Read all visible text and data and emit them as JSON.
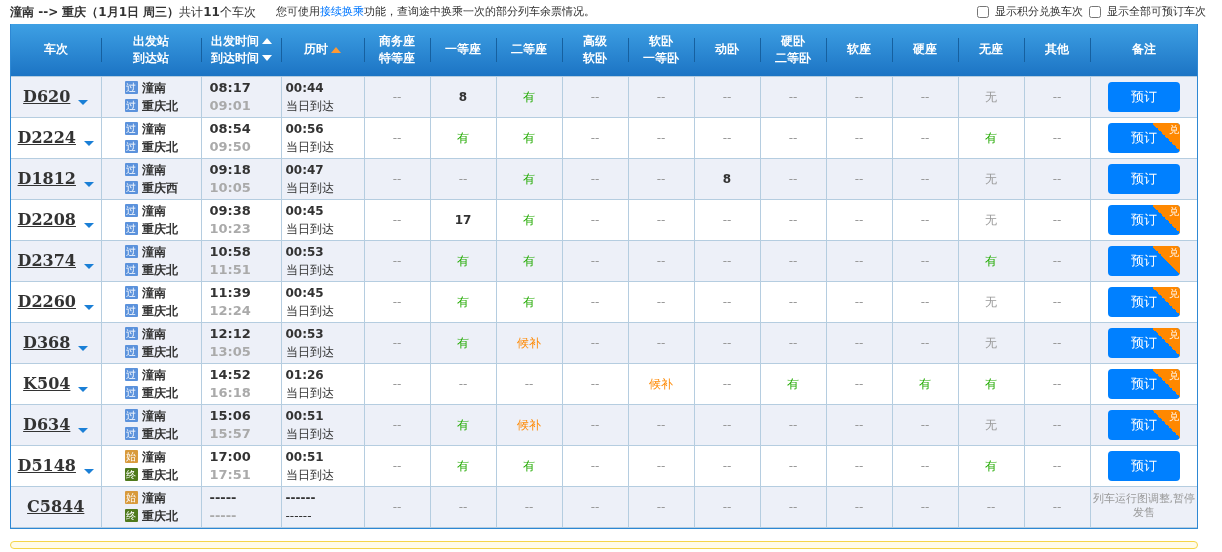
{
  "summary": "**潼南 --> 重庆（1月1日  周三）**共计**11**个车次",
  "notice": {
    "before": "您可使用",
    "link": "接续换乘",
    "after": "功能，查询途中换乘一次的部分列车余票情况。"
  },
  "filters": [
    {
      "label": "显示积分兑换车次",
      "checked": false
    },
    {
      "label": "显示全部可预订车次",
      "checked": false
    }
  ],
  "columns": [
    {
      "lines": [
        "车次"
      ]
    },
    {
      "lines": [
        "出发站",
        "到达站"
      ]
    },
    {
      "lines": [
        "出发时间",
        "到达时间"
      ],
      "sortable": true,
      "sort_active": false
    },
    {
      "lines": [
        "历时"
      ],
      "sortable": true,
      "sort_active": true
    },
    {
      "lines": [
        "商务座",
        "特等座"
      ]
    },
    {
      "lines": [
        "一等座"
      ]
    },
    {
      "lines": [
        "二等座"
      ]
    },
    {
      "lines": [
        "高级",
        "软卧"
      ]
    },
    {
      "lines": [
        "软卧",
        "一等卧"
      ]
    },
    {
      "lines": [
        "动卧"
      ]
    },
    {
      "lines": [
        "硬卧",
        "二等卧"
      ]
    },
    {
      "lines": [
        "软座"
      ]
    },
    {
      "lines": [
        "硬座"
      ]
    },
    {
      "lines": [
        "无座"
      ]
    },
    {
      "lines": [
        "其他"
      ]
    },
    {
      "lines": [
        "备注"
      ]
    }
  ],
  "rows": [
    {
      "train": "D620",
      "from": {
        "tag": "过",
        "kind": "pass",
        "name": "潼南"
      },
      "to": {
        "tag": "过",
        "kind": "pass",
        "name": "重庆北"
      },
      "depart": "08:17",
      "arrive": "09:01",
      "duration": "00:44",
      "arrival_day": "当日到达",
      "seats": [
        {
          "text": "--",
          "kind": "na"
        },
        {
          "text": "8",
          "kind": "count"
        },
        {
          "text": "有",
          "kind": "yes"
        },
        {
          "text": "--",
          "kind": "na"
        },
        {
          "text": "--",
          "kind": "na"
        },
        {
          "text": "--",
          "kind": "na"
        },
        {
          "text": "--",
          "kind": "na"
        },
        {
          "text": "--",
          "kind": "na"
        },
        {
          "text": "--",
          "kind": "na"
        },
        {
          "text": "无",
          "kind": "none"
        },
        {
          "text": "--",
          "kind": "na"
        }
      ],
      "button": {
        "label": "预订"
      }
    },
    {
      "train": "D2224",
      "from": {
        "tag": "过",
        "kind": "pass",
        "name": "潼南"
      },
      "to": {
        "tag": "过",
        "kind": "pass",
        "name": "重庆北"
      },
      "depart": "08:54",
      "arrive": "09:50",
      "duration": "00:56",
      "arrival_day": "当日到达",
      "seats": [
        {
          "text": "--",
          "kind": "na"
        },
        {
          "text": "有",
          "kind": "yes"
        },
        {
          "text": "有",
          "kind": "yes"
        },
        {
          "text": "--",
          "kind": "na"
        },
        {
          "text": "--",
          "kind": "na"
        },
        {
          "text": "--",
          "kind": "na"
        },
        {
          "text": "--",
          "kind": "na"
        },
        {
          "text": "--",
          "kind": "na"
        },
        {
          "text": "--",
          "kind": "na"
        },
        {
          "text": "有",
          "kind": "yes"
        },
        {
          "text": "--",
          "kind": "na"
        }
      ],
      "button": {
        "label": "预订",
        "corner": "兑"
      }
    },
    {
      "train": "D1812",
      "from": {
        "tag": "过",
        "kind": "pass",
        "name": "潼南"
      },
      "to": {
        "tag": "过",
        "kind": "pass",
        "name": "重庆西"
      },
      "depart": "09:18",
      "arrive": "10:05",
      "duration": "00:47",
      "arrival_day": "当日到达",
      "seats": [
        {
          "text": "--",
          "kind": "na"
        },
        {
          "text": "--",
          "kind": "na"
        },
        {
          "text": "有",
          "kind": "yes"
        },
        {
          "text": "--",
          "kind": "na"
        },
        {
          "text": "--",
          "kind": "na"
        },
        {
          "text": "8",
          "kind": "count"
        },
        {
          "text": "--",
          "kind": "na"
        },
        {
          "text": "--",
          "kind": "na"
        },
        {
          "text": "--",
          "kind": "na"
        },
        {
          "text": "无",
          "kind": "none"
        },
        {
          "text": "--",
          "kind": "na"
        }
      ],
      "button": {
        "label": "预订"
      }
    },
    {
      "train": "D2208",
      "from": {
        "tag": "过",
        "kind": "pass",
        "name": "潼南"
      },
      "to": {
        "tag": "过",
        "kind": "pass",
        "name": "重庆北"
      },
      "depart": "09:38",
      "arrive": "10:23",
      "duration": "00:45",
      "arrival_day": "当日到达",
      "seats": [
        {
          "text": "--",
          "kind": "na"
        },
        {
          "text": "17",
          "kind": "count"
        },
        {
          "text": "有",
          "kind": "yes"
        },
        {
          "text": "--",
          "kind": "na"
        },
        {
          "text": "--",
          "kind": "na"
        },
        {
          "text": "--",
          "kind": "na"
        },
        {
          "text": "--",
          "kind": "na"
        },
        {
          "text": "--",
          "kind": "na"
        },
        {
          "text": "--",
          "kind": "na"
        },
        {
          "text": "无",
          "kind": "none"
        },
        {
          "text": "--",
          "kind": "na"
        }
      ],
      "button": {
        "label": "预订",
        "corner": "兑"
      }
    },
    {
      "train": "D2374",
      "from": {
        "tag": "过",
        "kind": "pass",
        "name": "潼南"
      },
      "to": {
        "tag": "过",
        "kind": "pass",
        "name": "重庆北"
      },
      "depart": "10:58",
      "arrive": "11:51",
      "duration": "00:53",
      "arrival_day": "当日到达",
      "seats": [
        {
          "text": "--",
          "kind": "na"
        },
        {
          "text": "有",
          "kind": "yes"
        },
        {
          "text": "有",
          "kind": "yes"
        },
        {
          "text": "--",
          "kind": "na"
        },
        {
          "text": "--",
          "kind": "na"
        },
        {
          "text": "--",
          "kind": "na"
        },
        {
          "text": "--",
          "kind": "na"
        },
        {
          "text": "--",
          "kind": "na"
        },
        {
          "text": "--",
          "kind": "na"
        },
        {
          "text": "有",
          "kind": "yes"
        },
        {
          "text": "--",
          "kind": "na"
        }
      ],
      "button": {
        "label": "预订",
        "corner": "兑"
      }
    },
    {
      "train": "D2260",
      "from": {
        "tag": "过",
        "kind": "pass",
        "name": "潼南"
      },
      "to": {
        "tag": "过",
        "kind": "pass",
        "name": "重庆北"
      },
      "depart": "11:39",
      "arrive": "12:24",
      "duration": "00:45",
      "arrival_day": "当日到达",
      "seats": [
        {
          "text": "--",
          "kind": "na"
        },
        {
          "text": "有",
          "kind": "yes"
        },
        {
          "text": "有",
          "kind": "yes"
        },
        {
          "text": "--",
          "kind": "na"
        },
        {
          "text": "--",
          "kind": "na"
        },
        {
          "text": "--",
          "kind": "na"
        },
        {
          "text": "--",
          "kind": "na"
        },
        {
          "text": "--",
          "kind": "na"
        },
        {
          "text": "--",
          "kind": "na"
        },
        {
          "text": "无",
          "kind": "none"
        },
        {
          "text": "--",
          "kind": "na"
        }
      ],
      "button": {
        "label": "预订",
        "corner": "兑"
      }
    },
    {
      "train": "D368",
      "from": {
        "tag": "过",
        "kind": "pass",
        "name": "潼南"
      },
      "to": {
        "tag": "过",
        "kind": "pass",
        "name": "重庆北"
      },
      "depart": "12:12",
      "arrive": "13:05",
      "duration": "00:53",
      "arrival_day": "当日到达",
      "seats": [
        {
          "text": "--",
          "kind": "na"
        },
        {
          "text": "有",
          "kind": "yes"
        },
        {
          "text": "候补",
          "kind": "waitlist"
        },
        {
          "text": "--",
          "kind": "na"
        },
        {
          "text": "--",
          "kind": "na"
        },
        {
          "text": "--",
          "kind": "na"
        },
        {
          "text": "--",
          "kind": "na"
        },
        {
          "text": "--",
          "kind": "na"
        },
        {
          "text": "--",
          "kind": "na"
        },
        {
          "text": "无",
          "kind": "none"
        },
        {
          "text": "--",
          "kind": "na"
        }
      ],
      "button": {
        "label": "预订",
        "corner": "兑"
      }
    },
    {
      "train": "K504",
      "from": {
        "tag": "过",
        "kind": "pass",
        "name": "潼南"
      },
      "to": {
        "tag": "过",
        "kind": "pass",
        "name": "重庆北"
      },
      "depart": "14:52",
      "arrive": "16:18",
      "duration": "01:26",
      "arrival_day": "当日到达",
      "seats": [
        {
          "text": "--",
          "kind": "na"
        },
        {
          "text": "--",
          "kind": "na"
        },
        {
          "text": "--",
          "kind": "na"
        },
        {
          "text": "--",
          "kind": "na"
        },
        {
          "text": "候补",
          "kind": "waitlist"
        },
        {
          "text": "--",
          "kind": "na"
        },
        {
          "text": "有",
          "kind": "yes"
        },
        {
          "text": "--",
          "kind": "na"
        },
        {
          "text": "有",
          "kind": "yes"
        },
        {
          "text": "有",
          "kind": "yes"
        },
        {
          "text": "--",
          "kind": "na"
        }
      ],
      "button": {
        "label": "预订",
        "corner": "兑"
      }
    },
    {
      "train": "D634",
      "from": {
        "tag": "过",
        "kind": "pass",
        "name": "潼南"
      },
      "to": {
        "tag": "过",
        "kind": "pass",
        "name": "重庆北"
      },
      "depart": "15:06",
      "arrive": "15:57",
      "duration": "00:51",
      "arrival_day": "当日到达",
      "seats": [
        {
          "text": "--",
          "kind": "na"
        },
        {
          "text": "有",
          "kind": "yes"
        },
        {
          "text": "候补",
          "kind": "waitlist"
        },
        {
          "text": "--",
          "kind": "na"
        },
        {
          "text": "--",
          "kind": "na"
        },
        {
          "text": "--",
          "kind": "na"
        },
        {
          "text": "--",
          "kind": "na"
        },
        {
          "text": "--",
          "kind": "na"
        },
        {
          "text": "--",
          "kind": "na"
        },
        {
          "text": "无",
          "kind": "none"
        },
        {
          "text": "--",
          "kind": "na"
        }
      ],
      "button": {
        "label": "预订",
        "corner": "兑"
      }
    },
    {
      "train": "D5148",
      "from": {
        "tag": "始",
        "kind": "start",
        "name": "潼南"
      },
      "to": {
        "tag": "终",
        "kind": "end",
        "name": "重庆北"
      },
      "depart": "17:00",
      "arrive": "17:51",
      "duration": "00:51",
      "arrival_day": "当日到达",
      "seats": [
        {
          "text": "--",
          "kind": "na"
        },
        {
          "text": "有",
          "kind": "yes"
        },
        {
          "text": "有",
          "kind": "yes"
        },
        {
          "text": "--",
          "kind": "na"
        },
        {
          "text": "--",
          "kind": "na"
        },
        {
          "text": "--",
          "kind": "na"
        },
        {
          "text": "--",
          "kind": "na"
        },
        {
          "text": "--",
          "kind": "na"
        },
        {
          "text": "--",
          "kind": "na"
        },
        {
          "text": "有",
          "kind": "yes"
        },
        {
          "text": "--",
          "kind": "na"
        }
      ],
      "button": {
        "label": "预订"
      }
    },
    {
      "train": "C5844",
      "from": {
        "tag": "始",
        "kind": "start",
        "name": "潼南"
      },
      "to": {
        "tag": "终",
        "kind": "end",
        "name": "重庆北"
      },
      "depart": "-----",
      "arrive": "-----",
      "duration": "------",
      "arrival_day": "------",
      "seats": [
        {
          "text": "--",
          "kind": "na"
        },
        {
          "text": "--",
          "kind": "na"
        },
        {
          "text": "--",
          "kind": "na"
        },
        {
          "text": "--",
          "kind": "na"
        },
        {
          "text": "--",
          "kind": "na"
        },
        {
          "text": "--",
          "kind": "na"
        },
        {
          "text": "--",
          "kind": "na"
        },
        {
          "text": "--",
          "kind": "na"
        },
        {
          "text": "--",
          "kind": "na"
        },
        {
          "text": "--",
          "kind": "na"
        },
        {
          "text": "--",
          "kind": "na"
        }
      ],
      "note": "列车运行图调整,暂停发售"
    }
  ]
}
